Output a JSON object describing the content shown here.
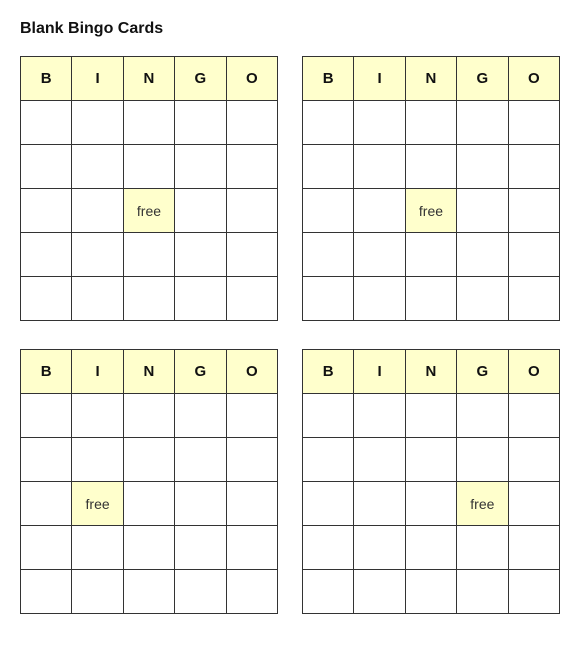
{
  "page": {
    "title": "Blank Bingo Cards"
  },
  "cards": [
    {
      "id": "card-1",
      "headers": [
        "B",
        "I",
        "N",
        "G",
        "O"
      ],
      "free_cell": {
        "row": 2,
        "col": 2
      }
    },
    {
      "id": "card-2",
      "headers": [
        "B",
        "I",
        "N",
        "G",
        "O"
      ],
      "free_cell": {
        "row": 2,
        "col": 2
      }
    },
    {
      "id": "card-3",
      "headers": [
        "B",
        "I",
        "N",
        "G",
        "O"
      ],
      "free_cell": {
        "row": 2,
        "col": 1
      }
    },
    {
      "id": "card-4",
      "headers": [
        "B",
        "I",
        "N",
        "G",
        "O"
      ],
      "free_cell": {
        "row": 2,
        "col": 3
      }
    }
  ],
  "free_label": "free"
}
